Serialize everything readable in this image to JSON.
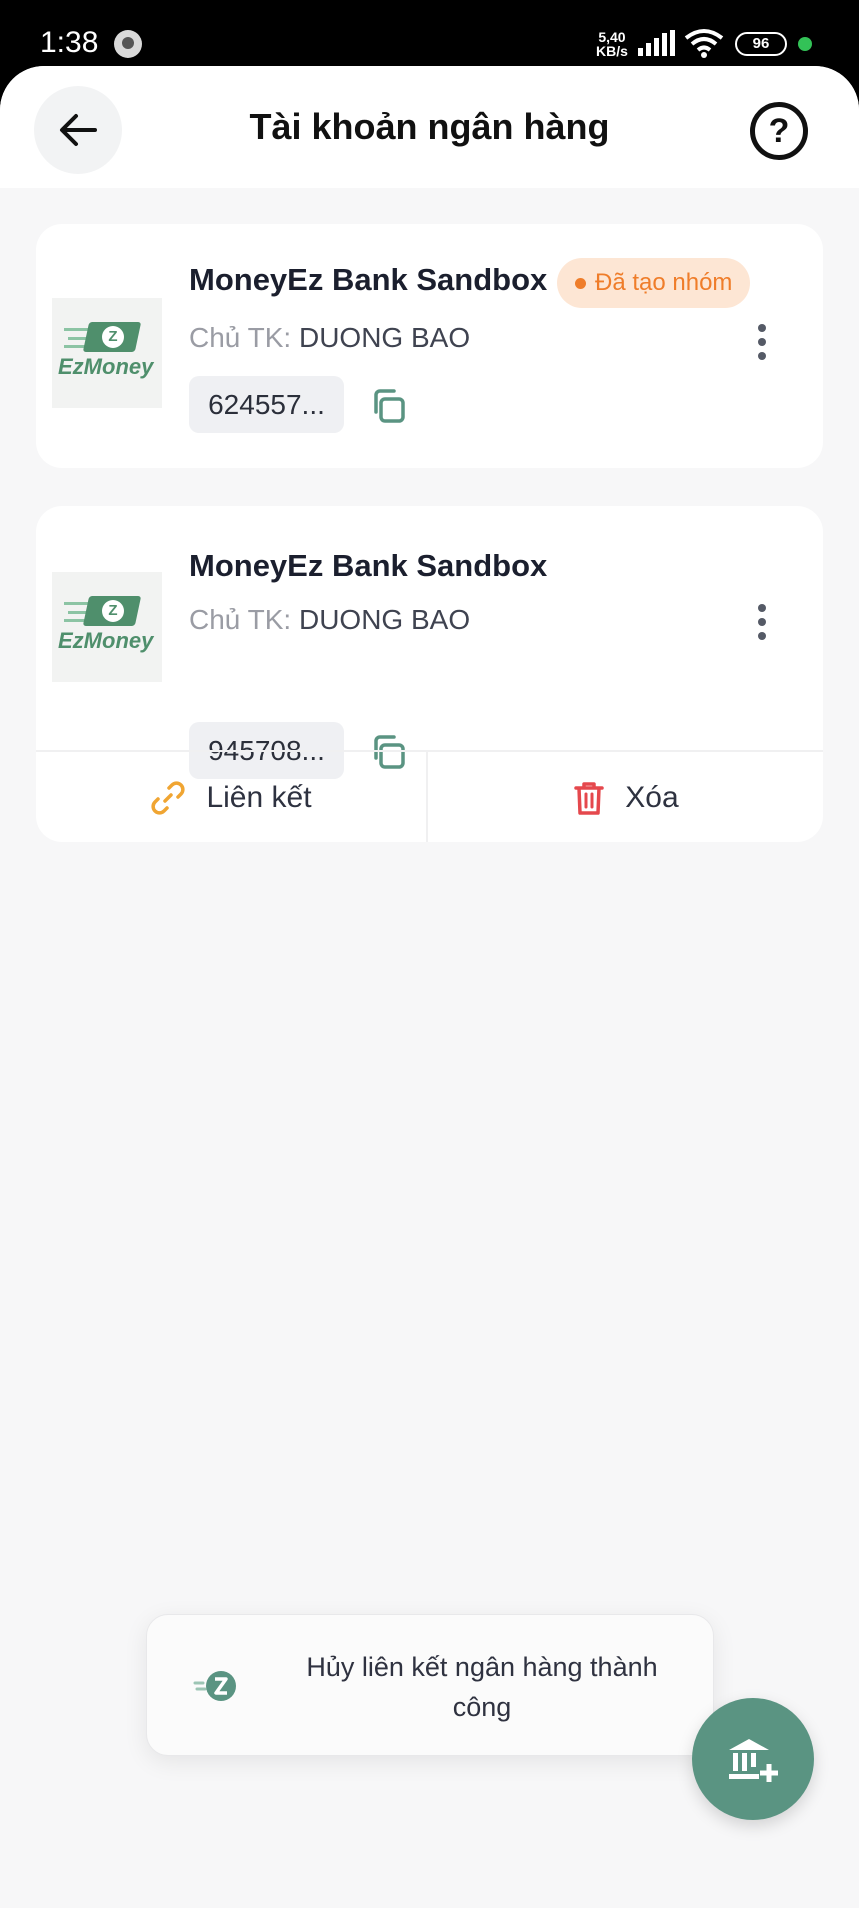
{
  "status_bar": {
    "time": "1:38",
    "net_speed_value": "5,40",
    "net_speed_unit": "KB/s",
    "battery": "96"
  },
  "header": {
    "title": "Tài khoản ngân hàng",
    "back_icon": "arrow-left-icon",
    "help_icon": "question-circle-icon",
    "help_glyph": "?"
  },
  "accounts": [
    {
      "bank_name": "MoneyEz Bank Sandbox",
      "owner_label": "Chủ TK:",
      "owner_name": "DUONG BAO",
      "account_number": "624557...",
      "badge": "Đã tạo nhóm",
      "logo_text": "EzMoney"
    },
    {
      "bank_name": "MoneyEz Bank Sandbox",
      "owner_label": "Chủ TK:",
      "owner_name": "DUONG BAO",
      "account_number": "945708...",
      "logo_text": "EzMoney",
      "actions": {
        "link_label": "Liên kết",
        "delete_label": "Xóa"
      }
    }
  ],
  "toast": {
    "message": "Hủy liên kết ngân hàng thành công"
  },
  "colors": {
    "accent": "#5a9482",
    "badge_bg": "#fde6d4",
    "badge_text": "#ef7d2a",
    "link_icon": "#f0a532",
    "delete_icon": "#e5484d"
  },
  "fab": {
    "icon": "bank-add-icon"
  }
}
